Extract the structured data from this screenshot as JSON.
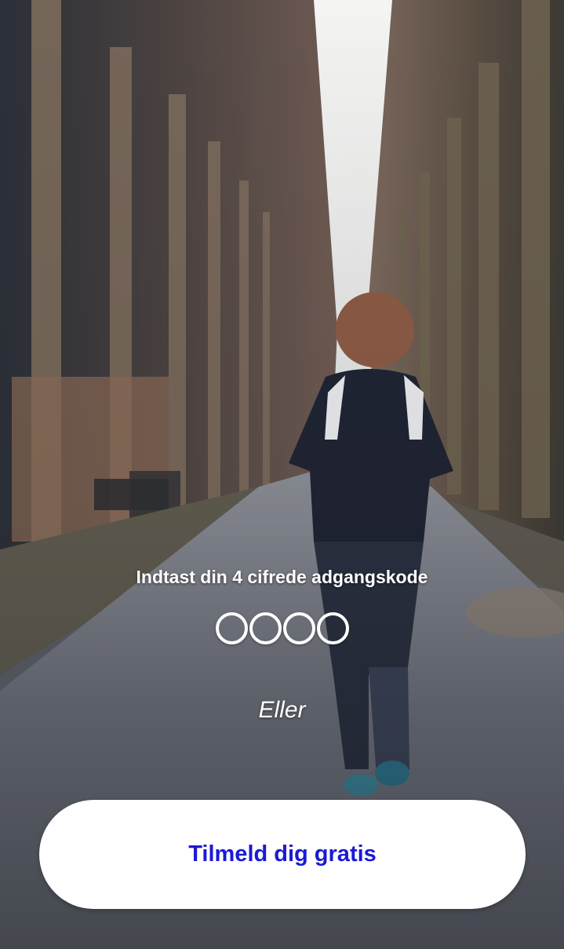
{
  "login": {
    "pin_prompt": "Indtast din 4 cifrede adgangskode",
    "pin_digits": [
      {
        "filled": false
      },
      {
        "filled": false
      },
      {
        "filled": false
      },
      {
        "filled": false
      }
    ],
    "or_label": "Eller",
    "signup_label": "Tilmeld dig gratis"
  },
  "colors": {
    "button_text": "#1a1ad6",
    "button_background": "#ffffff",
    "overlay_text": "#ffffff"
  },
  "background": {
    "subject": "runner on tree-lined park path"
  }
}
